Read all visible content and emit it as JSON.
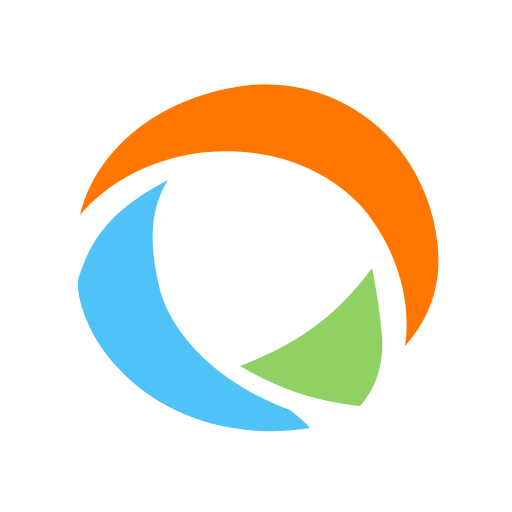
{
  "logo": {
    "colors": {
      "orange": "#FF7700",
      "blue": "#4FC3F7",
      "green": "#8FD163",
      "background": "#FFFFFF"
    }
  }
}
